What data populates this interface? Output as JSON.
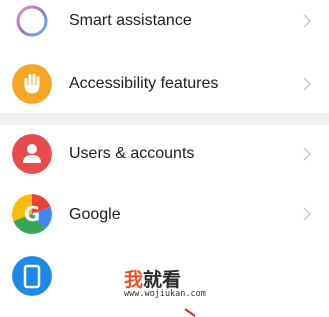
{
  "settings": {
    "items": [
      {
        "label": "Smart assistance",
        "icon": "smart-assistance-icon",
        "color": "#6b7cf0"
      },
      {
        "label": "Accessibility features",
        "icon": "hand-icon",
        "color": "#f6a623"
      },
      {
        "label": "Users & accounts",
        "icon": "user-icon",
        "color": "#e84b4b"
      },
      {
        "label": "Google",
        "icon": "google-icon",
        "color": "#4285f4"
      },
      {
        "label": "",
        "icon": "system-icon",
        "color": "#1e88e5"
      }
    ]
  },
  "watermark": {
    "char1": "我",
    "char2": "就看",
    "url": "www.wojiukan.com"
  }
}
